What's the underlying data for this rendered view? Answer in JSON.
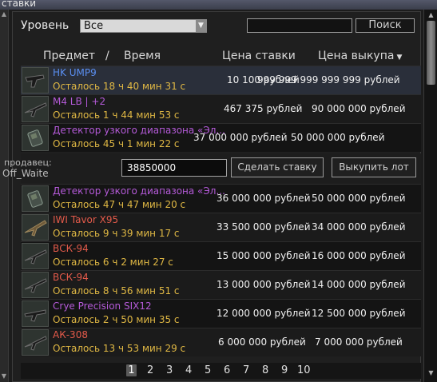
{
  "window": {
    "title": "ставки"
  },
  "filter": {
    "label": "Уровень",
    "selected": "Все"
  },
  "search": {
    "placeholder": "",
    "button_label": "Поиск"
  },
  "columns": {
    "item": "Предмет",
    "separator": "/",
    "time": "Время",
    "bid": "Цена ставки",
    "buyout": "Цена выкупа",
    "buyout_sort_icon": "sort-down-triangle"
  },
  "lots": [
    {
      "name": "HK UMP9",
      "name_color": "#5a8ef0",
      "time_left": "Осталось 18 ч 40 мин 31 с",
      "bid_price": "10 100 рублей",
      "buyout_price": "999 999 999 999 999 рублей",
      "icon": "smg-icon"
    },
    {
      "name": "M4 LB | +2",
      "name_color": "#b45ad8",
      "time_left": "Осталось 1 ч 44 мин 53 с",
      "bid_price": "467 375 рублей",
      "buyout_price": "90 000 000 рублей",
      "icon": "rifle-icon"
    },
    {
      "name": "Детектор узкого диапазона «Эл...",
      "name_color": "#b45ad8",
      "time_left": "Осталось 45 ч 1 мин 22 с",
      "bid_price": "37 000 000 рублей",
      "buyout_price": "50 000 000 рублей",
      "icon": "detector-icon"
    },
    {
      "name": "Детектор узкого диапазона «Эл...",
      "name_color": "#b45ad8",
      "time_left": "Осталось 47 ч 47 мин 20 с",
      "bid_price": "36 000 000 рублей",
      "buyout_price": "50 000 000 рублей",
      "icon": "detector-icon"
    },
    {
      "name": "IWI Tavor X95",
      "name_color": "#e35a4a",
      "time_left": "Осталось 9 ч 39 мин 17 с",
      "bid_price": "33 500 000 рублей",
      "buyout_price": "34 000 000 рублей",
      "icon": "rifle-icon"
    },
    {
      "name": "ВСК-94",
      "name_color": "#e35a4a",
      "time_left": "Осталось 6 ч 2 мин 27 с",
      "bid_price": "15 000 000 рублей",
      "buyout_price": "16 000 000 рублей",
      "icon": "rifle-icon"
    },
    {
      "name": "ВСК-94",
      "name_color": "#e35a4a",
      "time_left": "Осталось 8 ч 56 мин 51 с",
      "bid_price": "13 000 000 рублей",
      "buyout_price": "14 000 000 рублей",
      "icon": "rifle-icon"
    },
    {
      "name": "Crye Precision SIX12",
      "name_color": "#b45ad8",
      "time_left": "Осталось 2 ч 50 мин 35 с",
      "bid_price": "12 000 000 рублей",
      "buyout_price": "12 500 000 рублей",
      "icon": "shotgun-icon"
    },
    {
      "name": "АК-308",
      "name_color": "#e35a4a",
      "time_left": "Осталось 13 ч 53 мин 29 с",
      "bid_price": "6 000 000 рублей",
      "buyout_price": "7 000 000 рублей",
      "icon": "rifle-icon"
    }
  ],
  "selected_lot": {
    "seller_label": "продавец:",
    "seller_name": "Off_Waite",
    "bid_value": "38850000",
    "bid_button": "Сделать ставку",
    "buyout_button": "Выкупить лот"
  },
  "pagination": {
    "pages": [
      "1",
      "2",
      "3",
      "4",
      "5",
      "6",
      "7",
      "8",
      "9",
      "10"
    ],
    "current": "1"
  }
}
